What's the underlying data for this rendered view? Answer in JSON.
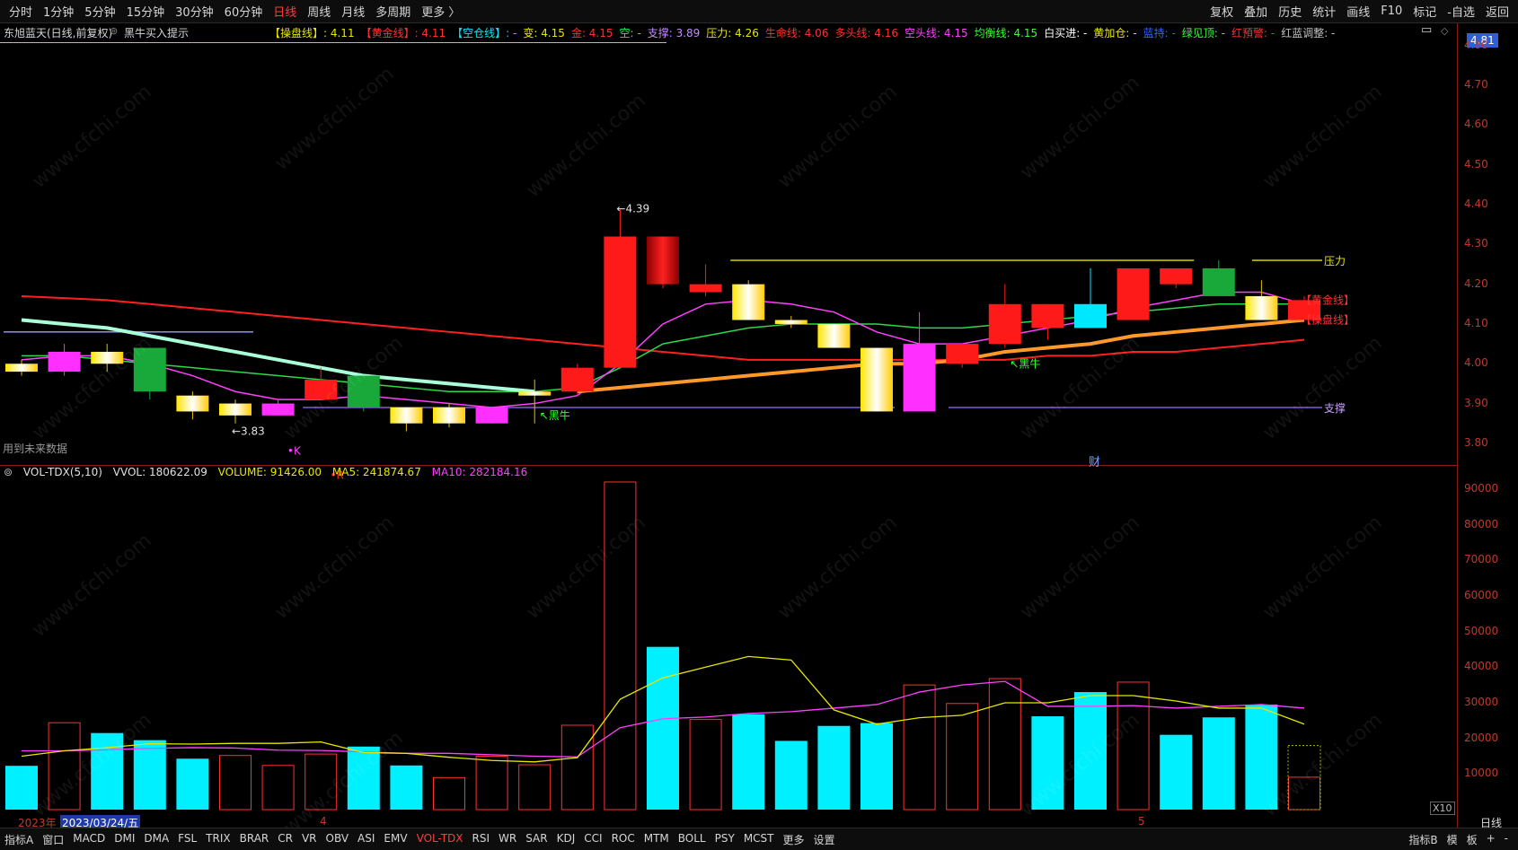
{
  "toolbar": {
    "left": [
      "分时",
      "1分钟",
      "5分钟",
      "15分钟",
      "30分钟",
      "60分钟",
      "日线",
      "周线",
      "月线",
      "多周期",
      "更多 〉"
    ],
    "active": "日线",
    "right": [
      "复权",
      "叠加",
      "历史",
      "统计",
      "画线",
      "F10",
      "标记",
      "-自选",
      "返回"
    ]
  },
  "stock": {
    "title": "东旭蓝天(日线,前复权)",
    "indicator_name": "黑牛买入提示",
    "current_price": "4.81",
    "future_note": "用到未来数据",
    "finance_mark": "财"
  },
  "info_items": [
    {
      "text": "【操盘线】: 4.11",
      "color": "#e6e600"
    },
    {
      "text": "【黄金线】: 4.11",
      "color": "#ff3030"
    },
    {
      "text": "【空仓线】: -",
      "color": "#00e5ff"
    },
    {
      "text": "变: 4.15",
      "color": "#e6e600"
    },
    {
      "text": "金: 4.15",
      "color": "#ff3030"
    },
    {
      "text": "空: -",
      "color": "#00ff66"
    },
    {
      "text": "支撑: 3.89",
      "color": "#c48bff"
    },
    {
      "text": "压力: 4.26",
      "color": "#e6e600"
    },
    {
      "text": "生命线: 4.06",
      "color": "#ff3030"
    },
    {
      "text": "多头线: 4.16",
      "color": "#ff3030"
    },
    {
      "text": "空头线: 4.15",
      "color": "#ff40ff"
    },
    {
      "text": "均衡线: 4.15",
      "color": "#33ff33"
    },
    {
      "text": "白买进: -",
      "color": "#ffffff"
    },
    {
      "text": "黄加仓: -",
      "color": "#e6e600"
    },
    {
      "text": "蓝持: -",
      "color": "#3366ff"
    },
    {
      "text": "绿见顶: -",
      "color": "#33ff33"
    },
    {
      "text": "红預警: -",
      "color": "#ff3030"
    },
    {
      "text": "红蓝调整: -",
      "color": "#c0c0c0"
    }
  ],
  "volume_header": {
    "name": "VOL-TDX(5,10)",
    "vvol": "VVOL: 180622.09",
    "volume": "VOLUME: 91426.00",
    "ma5": "MA5: 241874.67",
    "ma10": "MA10: 282184.16",
    "scale_note": "X10"
  },
  "dates": {
    "year": "2023年",
    "cursor": "2023/03/24/五",
    "month4": "4",
    "month5": "5"
  },
  "bottom_tabs": [
    "指标A",
    "窗口",
    "MACD",
    "DMI",
    "DMA",
    "FSL",
    "TRIX",
    "BRAR",
    "CR",
    "VR",
    "OBV",
    "ASI",
    "EMV",
    "VOL-TDX",
    "RSI",
    "WR",
    "SAR",
    "KDJ",
    "CCI",
    "ROC",
    "MTM",
    "BOLL",
    "PSY",
    "MCST",
    "更多",
    "设置"
  ],
  "bottom_active": "VOL-TDX",
  "bottom_right": [
    "指标B",
    "模",
    "板",
    "+",
    "-"
  ],
  "period_label": "日线",
  "chart_data": [
    {
      "type": "candlestick",
      "title": "东旭蓝天(日线,前复权)",
      "ylim": [
        3.75,
        4.82
      ],
      "y_ticks": [
        3.8,
        3.9,
        4.0,
        4.1,
        4.2,
        4.3,
        4.4,
        4.5,
        4.6,
        4.7,
        4.8
      ],
      "candles": [
        {
          "o": 4.0,
          "h": 4.01,
          "l": 3.97,
          "c": 3.98,
          "col": "yellow"
        },
        {
          "o": 3.98,
          "h": 4.05,
          "l": 3.97,
          "c": 4.03,
          "col": "magenta"
        },
        {
          "o": 4.03,
          "h": 4.05,
          "l": 3.98,
          "c": 4.0,
          "col": "yellow"
        },
        {
          "o": 4.04,
          "h": 4.04,
          "l": 3.91,
          "c": 3.93,
          "col": "green"
        },
        {
          "o": 3.92,
          "h": 3.93,
          "l": 3.86,
          "c": 3.88,
          "col": "yellow"
        },
        {
          "o": 3.9,
          "h": 3.91,
          "l": 3.85,
          "c": 3.87,
          "col": "yellow"
        },
        {
          "o": 3.87,
          "h": 3.91,
          "l": 3.87,
          "c": 3.9,
          "col": "magenta"
        },
        {
          "o": 3.91,
          "h": 3.99,
          "l": 3.91,
          "c": 3.96,
          "col": "red"
        },
        {
          "o": 3.97,
          "h": 3.97,
          "l": 3.88,
          "c": 3.89,
          "col": "green"
        },
        {
          "o": 3.89,
          "h": 3.89,
          "l": 3.83,
          "c": 3.85,
          "col": "yellow"
        },
        {
          "o": 3.85,
          "h": 3.9,
          "l": 3.84,
          "c": 3.89,
          "col": "yellow"
        },
        {
          "o": 3.89,
          "h": 3.89,
          "l": 3.85,
          "c": 3.85,
          "col": "magenta"
        },
        {
          "o": 3.93,
          "h": 3.96,
          "l": 3.85,
          "c": 3.92,
          "col": "yellow"
        },
        {
          "o": 3.93,
          "h": 4.0,
          "l": 3.92,
          "c": 3.99,
          "col": "red"
        },
        {
          "o": 3.99,
          "h": 4.39,
          "l": 3.99,
          "c": 4.32,
          "col": "red"
        },
        {
          "o": 4.32,
          "h": 4.32,
          "l": 4.19,
          "c": 4.2,
          "col": "red"
        },
        {
          "o": 4.2,
          "h": 4.25,
          "l": 4.17,
          "c": 4.18,
          "col": "red"
        },
        {
          "o": 4.2,
          "h": 4.21,
          "l": 4.11,
          "c": 4.11,
          "col": "yellow"
        },
        {
          "o": 4.11,
          "h": 4.12,
          "l": 4.09,
          "c": 4.1,
          "col": "yellow"
        },
        {
          "o": 4.1,
          "h": 4.1,
          "l": 4.04,
          "c": 4.04,
          "col": "yellow"
        },
        {
          "o": 4.04,
          "h": 4.04,
          "l": 3.88,
          "c": 3.88,
          "col": "yellow"
        },
        {
          "o": 3.88,
          "h": 4.13,
          "l": 3.88,
          "c": 4.05,
          "col": "magenta"
        },
        {
          "o": 4.0,
          "h": 4.05,
          "l": 3.99,
          "c": 4.05,
          "col": "red"
        },
        {
          "o": 4.05,
          "h": 4.2,
          "l": 4.04,
          "c": 4.15,
          "col": "red"
        },
        {
          "o": 4.09,
          "h": 4.15,
          "l": 4.06,
          "c": 4.15,
          "col": "red"
        },
        {
          "o": 4.09,
          "h": 4.24,
          "l": 4.09,
          "c": 4.15,
          "col": "cyan"
        },
        {
          "o": 4.11,
          "h": 4.24,
          "l": 4.11,
          "c": 4.24,
          "col": "red"
        },
        {
          "o": 4.24,
          "h": 4.24,
          "l": 4.19,
          "c": 4.2,
          "col": "red"
        },
        {
          "o": 4.17,
          "h": 4.26,
          "l": 4.17,
          "c": 4.24,
          "col": "green"
        },
        {
          "o": 4.17,
          "h": 4.21,
          "l": 4.11,
          "c": 4.11,
          "col": "yellow"
        },
        {
          "o": 4.16,
          "h": 4.17,
          "l": 4.11,
          "c": 4.11,
          "col": "red"
        }
      ],
      "lines": [
        {
          "name": "生命线",
          "color": "#ff2020",
          "width": 2,
          "points": [
            4.17,
            4.165,
            4.16,
            4.15,
            4.14,
            4.13,
            4.12,
            4.11,
            4.1,
            4.09,
            4.08,
            4.07,
            4.06,
            4.05,
            4.04,
            4.03,
            4.02,
            4.01,
            4.01,
            4.01,
            4.01,
            4.01,
            4.01,
            4.01,
            4.02,
            4.02,
            4.03,
            4.03,
            4.04,
            4.05,
            4.06
          ]
        },
        {
          "name": "均衡线",
          "color": "#2bd94a",
          "width": 1.5,
          "points": [
            4.02,
            4.02,
            4.01,
            4.0,
            3.99,
            3.98,
            3.97,
            3.96,
            3.95,
            3.94,
            3.93,
            3.93,
            3.93,
            3.94,
            3.99,
            4.05,
            4.07,
            4.09,
            4.1,
            4.1,
            4.1,
            4.09,
            4.09,
            4.1,
            4.11,
            4.12,
            4.13,
            4.14,
            4.15,
            4.15,
            4.15
          ]
        },
        {
          "name": "空头线",
          "color": "#ff40ff",
          "width": 1.5,
          "points": [
            4.01,
            4.02,
            4.02,
            4.0,
            3.97,
            3.93,
            3.91,
            3.91,
            3.92,
            3.91,
            3.9,
            3.89,
            3.9,
            3.92,
            4.0,
            4.1,
            4.15,
            4.16,
            4.15,
            4.13,
            4.08,
            4.05,
            4.05,
            4.07,
            4.09,
            4.11,
            4.14,
            4.16,
            4.18,
            4.18,
            4.15
          ]
        },
        {
          "name": "操盘线",
          "color": "#ff9a2a",
          "width": 4,
          "points": [
            null,
            null,
            null,
            null,
            null,
            null,
            null,
            null,
            null,
            null,
            null,
            null,
            null,
            3.93,
            3.94,
            3.95,
            3.96,
            3.97,
            3.98,
            3.99,
            4.0,
            4.0,
            4.01,
            4.03,
            4.04,
            4.05,
            4.07,
            4.08,
            4.09,
            4.1,
            4.11
          ]
        },
        {
          "name": "空仓线",
          "color": "#a8ffd8",
          "width": 4,
          "points": [
            4.11,
            4.1,
            4.09,
            4.07,
            4.05,
            4.03,
            4.01,
            3.99,
            3.97,
            3.96,
            3.95,
            3.94,
            3.93,
            null,
            null,
            null,
            null,
            null,
            null,
            null,
            null,
            null,
            null,
            null,
            null,
            null,
            null,
            null,
            null,
            null,
            null
          ]
        }
      ],
      "hlines": [
        {
          "value": 4.26,
          "from": 17,
          "to": 27,
          "color": "#e6e600",
          "label": ""
        },
        {
          "value": 4.26,
          "from": 29.2,
          "to": 30,
          "color": "#e6e600",
          "label": "压力"
        },
        {
          "value": 3.89,
          "from": 7,
          "to": 20,
          "color": "#9b6bff",
          "label": ""
        },
        {
          "value": 3.89,
          "from": 22.1,
          "to": 30,
          "color": "#9b6bff",
          "label": "支撑"
        },
        {
          "value": 4.08,
          "from": 0,
          "to": 5,
          "color": "#9b9bff",
          "label": ""
        }
      ],
      "annotations": [
        {
          "text": "4.39",
          "x": 14,
          "y": 4.39,
          "color": "#e0e0e0"
        },
        {
          "text": "3.83",
          "x": 5,
          "y": 3.83,
          "color": "#e0e0e0"
        },
        {
          "text": "黑牛",
          "x": 12.2,
          "y": 3.87,
          "color": "#33ff33"
        },
        {
          "text": "黑牛",
          "x": 23.2,
          "y": 4.0,
          "color": "#33ff33"
        },
        {
          "text": "K",
          "x": 6.3,
          "y": 3.78,
          "color": "#ff40ff"
        },
        {
          "text": "R",
          "x": 7.3,
          "y": 3.72,
          "color": "#ff3030"
        },
        {
          "text": "【黄金线】",
          "x": 30,
          "y": 4.16,
          "color": "#ff3030"
        },
        {
          "text": "【操盘线】",
          "x": 30,
          "y": 4.11,
          "color": "#ff3030"
        }
      ]
    },
    {
      "type": "bar",
      "title": "VOL-TDX(5,10)",
      "ylim": [
        0,
        93000
      ],
      "y_ticks": [
        10000,
        20000,
        30000,
        40000,
        50000,
        60000,
        70000,
        80000,
        90000
      ],
      "bars": [
        {
          "v": 12300,
          "fill": true
        },
        {
          "v": 24400,
          "fill": false
        },
        {
          "v": 21500,
          "fill": true
        },
        {
          "v": 19500,
          "fill": true
        },
        {
          "v": 14300,
          "fill": true
        },
        {
          "v": 15200,
          "fill": false
        },
        {
          "v": 12400,
          "fill": false
        },
        {
          "v": 15600,
          "fill": false
        },
        {
          "v": 17700,
          "fill": true
        },
        {
          "v": 12400,
          "fill": true
        },
        {
          "v": 9000,
          "fill": false
        },
        {
          "v": 15000,
          "fill": false
        },
        {
          "v": 12600,
          "fill": false
        },
        {
          "v": 23700,
          "fill": false
        },
        {
          "v": 92000,
          "fill": false
        },
        {
          "v": 45700,
          "fill": true
        },
        {
          "v": 25300,
          "fill": false
        },
        {
          "v": 26800,
          "fill": true
        },
        {
          "v": 19300,
          "fill": true
        },
        {
          "v": 23500,
          "fill": true
        },
        {
          "v": 24300,
          "fill": true
        },
        {
          "v": 35000,
          "fill": false
        },
        {
          "v": 29800,
          "fill": false
        },
        {
          "v": 36800,
          "fill": false
        },
        {
          "v": 26200,
          "fill": true
        },
        {
          "v": 33000,
          "fill": true
        },
        {
          "v": 35800,
          "fill": false
        },
        {
          "v": 21000,
          "fill": true
        },
        {
          "v": 25900,
          "fill": true
        },
        {
          "v": 29500,
          "fill": true
        },
        {
          "v": 9100,
          "fill": false
        }
      ],
      "ghost_bar": {
        "index": 30,
        "v": 18000
      },
      "ma5": [
        15000,
        16500,
        17400,
        18500,
        18400,
        18600,
        18600,
        19000,
        16000,
        15800,
        14700,
        13800,
        13400,
        14600,
        31000,
        37000,
        40000,
        43000,
        42000,
        28000,
        24000,
        25800,
        26500,
        30000,
        30000,
        32000,
        32000,
        30500,
        28500,
        28500,
        24000
      ],
      "ma10": [
        16500,
        16500,
        16800,
        17200,
        17400,
        17300,
        16700,
        16600,
        16200,
        15800,
        15800,
        15400,
        15000,
        14800,
        23000,
        25500,
        26000,
        27000,
        27500,
        28500,
        29500,
        33000,
        35000,
        36000,
        29000,
        29000,
        29200,
        28500,
        29000,
        29500,
        28500
      ]
    }
  ]
}
